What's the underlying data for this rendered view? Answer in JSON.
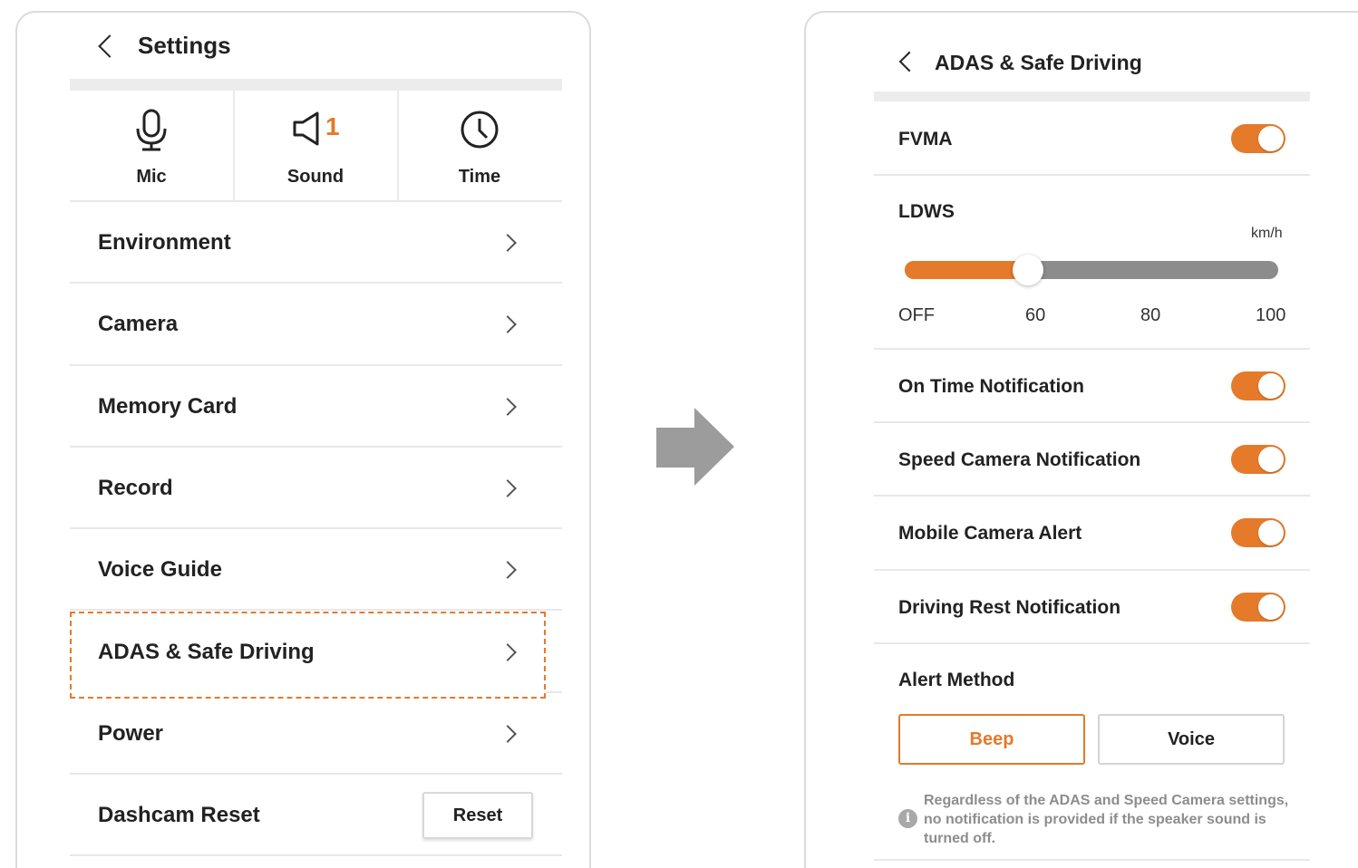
{
  "colors": {
    "accent": "#e47a2a",
    "text": "#222222",
    "separator": "#e8e8e8",
    "slider_track": "#8c8c8c"
  },
  "settings": {
    "title": "Settings",
    "quick": [
      {
        "label": "Mic",
        "icon": "mic-icon"
      },
      {
        "label": "Sound",
        "icon": "speaker-icon",
        "badge": "1"
      },
      {
        "label": "Time",
        "icon": "clock-icon"
      }
    ],
    "menu": [
      {
        "label": "Environment"
      },
      {
        "label": "Camera"
      },
      {
        "label": "Memory Card"
      },
      {
        "label": "Record"
      },
      {
        "label": "Voice Guide"
      },
      {
        "label": "ADAS & Safe Driving",
        "highlighted": true
      },
      {
        "label": "Power"
      }
    ],
    "reset_row": {
      "label": "Dashcam Reset",
      "button": "Reset"
    }
  },
  "adas": {
    "title": "ADAS & Safe Driving",
    "fvma": {
      "label": "FVMA",
      "on": true
    },
    "ldws": {
      "label": "LDWS",
      "unit": "km/h",
      "ticks": [
        "OFF",
        "60",
        "80",
        "100"
      ],
      "selected": "60",
      "fill_fraction": 0.33
    },
    "toggles": [
      {
        "label": "On Time Notification",
        "on": true
      },
      {
        "label": "Speed Camera Notification",
        "on": true
      },
      {
        "label": "Mobile Camera Alert",
        "on": true
      },
      {
        "label": "Driving Rest Notification",
        "on": true
      }
    ],
    "alert_method": {
      "label": "Alert Method",
      "options": [
        "Beep",
        "Voice"
      ],
      "selected": "Beep"
    },
    "note": "Regardless of the ADAS and Speed Camera settings, no notification is provided if the speaker sound is turned off."
  }
}
